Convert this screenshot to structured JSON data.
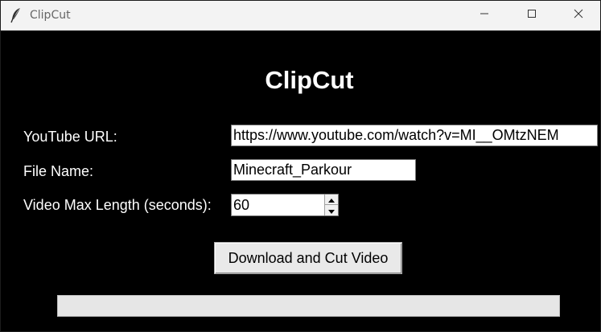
{
  "window": {
    "title": "ClipCut",
    "icon": "feather-icon",
    "controls": [
      "minimize-icon",
      "maximize-icon",
      "close-icon"
    ]
  },
  "app": {
    "heading": "ClipCut"
  },
  "form": {
    "url": {
      "label": "YouTube URL:",
      "value": "https://www.youtube.com/watch?v=MI__OMtzNEM"
    },
    "file_name": {
      "label": "File Name:",
      "value": "Minecraft_Parkour"
    },
    "max_length": {
      "label": "Video Max Length (seconds):",
      "value": "60"
    }
  },
  "actions": {
    "download_label": "Download and Cut Video"
  },
  "progress": {
    "value": 0
  },
  "colors": {
    "background": "#000000",
    "text": "#ffffff",
    "titlebar": "#f3f3f3"
  }
}
